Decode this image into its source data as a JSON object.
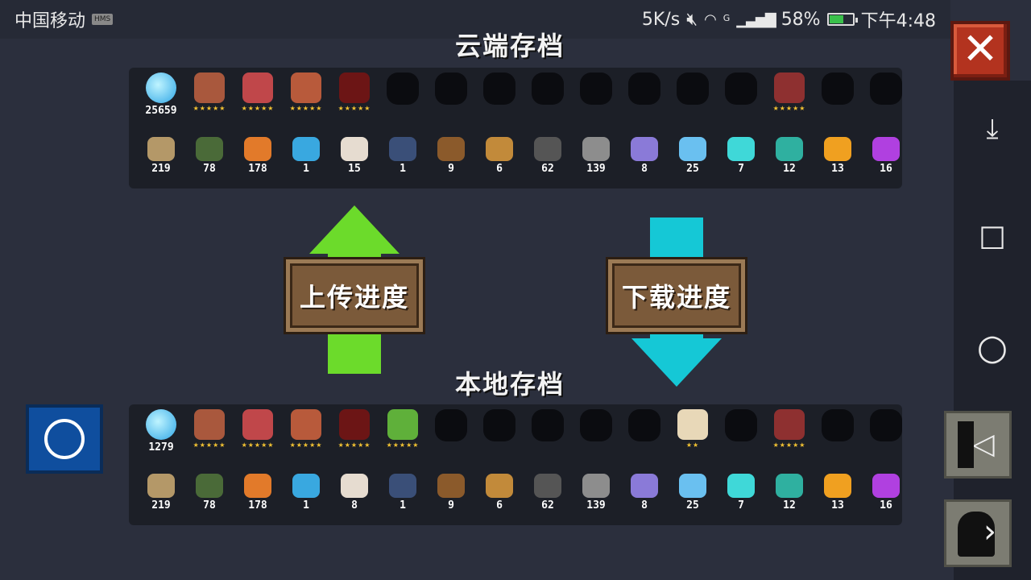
{
  "status_bar": {
    "carrier": "中国移动",
    "hms_badge": "HMS",
    "speed": "5K/s",
    "network_type": "G",
    "battery_percent": "58%",
    "battery_level": 0.58,
    "time": "下午4:48"
  },
  "cloud_save": {
    "title": "云端存档",
    "gem_count": "25659",
    "characters": [
      {
        "icon": "knight-character-icon",
        "unlocked": true,
        "stars": "★★★★★",
        "color": "#a9583d"
      },
      {
        "icon": "rogue-character-icon",
        "unlocked": true,
        "stars": "★★★★★",
        "color": "#c0474a"
      },
      {
        "icon": "wizard-character-icon",
        "unlocked": true,
        "stars": "★★★★★",
        "color": "#b85a3b"
      },
      {
        "icon": "assassin-character-icon",
        "unlocked": true,
        "stars": "★★★★★",
        "color": "#6c1515"
      },
      {
        "icon": "locked-character-icon",
        "unlocked": false,
        "stars": ""
      },
      {
        "icon": "locked-character-icon",
        "unlocked": false,
        "stars": ""
      },
      {
        "icon": "locked-character-icon",
        "unlocked": false,
        "stars": ""
      },
      {
        "icon": "locked-character-icon",
        "unlocked": false,
        "stars": ""
      },
      {
        "icon": "locked-character-icon",
        "unlocked": false,
        "stars": ""
      },
      {
        "icon": "locked-character-icon",
        "unlocked": false,
        "stars": ""
      },
      {
        "icon": "locked-character-icon",
        "unlocked": false,
        "stars": ""
      },
      {
        "icon": "locked-character-icon",
        "unlocked": false,
        "stars": ""
      },
      {
        "icon": "robot-character-icon",
        "unlocked": true,
        "stars": "★★★★★",
        "color": "#8e3030"
      },
      {
        "icon": "locked-character-icon",
        "unlocked": false,
        "stars": ""
      },
      {
        "icon": "locked-character-icon",
        "unlocked": false,
        "stars": ""
      }
    ],
    "materials": [
      {
        "icon": "wood-material-icon",
        "count": "219",
        "color": "#b49868"
      },
      {
        "icon": "battery-material-icon",
        "count": "78",
        "color": "#4a6a38"
      },
      {
        "icon": "ore-material-icon",
        "count": "178",
        "color": "#e27a2a"
      },
      {
        "icon": "energy-orb-icon",
        "count": "1",
        "color": "#39a8e0"
      },
      {
        "icon": "fabric-material-icon",
        "count": "15",
        "color": "#e6dcd0"
      },
      {
        "icon": "compass-material-icon",
        "count": "1",
        "color": "#3a4f78"
      },
      {
        "icon": "horn-material-icon",
        "count": "9",
        "color": "#8b5a2b"
      },
      {
        "icon": "feather-material-icon",
        "count": "6",
        "color": "#c28a3a"
      },
      {
        "icon": "gear-material-icon",
        "count": "62",
        "color": "#555"
      },
      {
        "icon": "iron-material-icon",
        "count": "139",
        "color": "#8d8d8d"
      },
      {
        "icon": "purple-crystal-icon",
        "count": "8",
        "color": "#8a7ad8"
      },
      {
        "icon": "blue-crystal-icon",
        "count": "25",
        "color": "#6ac0f0"
      },
      {
        "icon": "cyan-crystal-icon",
        "count": "7",
        "color": "#3fd8d8"
      },
      {
        "icon": "teal-crystal-icon",
        "count": "12",
        "color": "#2fb0a0"
      },
      {
        "icon": "orange-crystal-icon",
        "count": "13",
        "color": "#f0a020"
      },
      {
        "icon": "violet-crystal-icon",
        "count": "16",
        "color": "#b040e0"
      }
    ]
  },
  "local_save": {
    "title": "本地存档",
    "gem_count": "1279",
    "characters": [
      {
        "icon": "knight-character-icon",
        "unlocked": true,
        "stars": "★★★★★",
        "color": "#a9583d"
      },
      {
        "icon": "rogue-character-icon",
        "unlocked": true,
        "stars": "★★★★★",
        "color": "#c0474a"
      },
      {
        "icon": "wizard-character-icon",
        "unlocked": true,
        "stars": "★★★★★",
        "color": "#b85a3b"
      },
      {
        "icon": "assassin-character-icon",
        "unlocked": true,
        "stars": "★★★★★",
        "color": "#6c1515"
      },
      {
        "icon": "engineer-character-icon",
        "unlocked": true,
        "stars": "★★★★★",
        "color": "#5fb03a"
      },
      {
        "icon": "locked-character-icon",
        "unlocked": false,
        "stars": ""
      },
      {
        "icon": "locked-character-icon",
        "unlocked": false,
        "stars": ""
      },
      {
        "icon": "locked-character-icon",
        "unlocked": false,
        "stars": ""
      },
      {
        "icon": "locked-character-icon",
        "unlocked": false,
        "stars": ""
      },
      {
        "icon": "locked-character-icon",
        "unlocked": false,
        "stars": ""
      },
      {
        "icon": "priest-character-icon",
        "unlocked": true,
        "stars": "★★",
        "color": "#e8d8b8"
      },
      {
        "icon": "locked-character-icon",
        "unlocked": false,
        "stars": ""
      },
      {
        "icon": "robot-character-icon",
        "unlocked": true,
        "stars": "★★★★★",
        "color": "#8e3030"
      },
      {
        "icon": "locked-character-icon",
        "unlocked": false,
        "stars": ""
      },
      {
        "icon": "locked-character-icon",
        "unlocked": false,
        "stars": ""
      }
    ],
    "materials": [
      {
        "icon": "wood-material-icon",
        "count": "219",
        "color": "#b49868"
      },
      {
        "icon": "battery-material-icon",
        "count": "78",
        "color": "#4a6a38"
      },
      {
        "icon": "ore-material-icon",
        "count": "178",
        "color": "#e27a2a"
      },
      {
        "icon": "energy-orb-icon",
        "count": "1",
        "color": "#39a8e0"
      },
      {
        "icon": "fabric-material-icon",
        "count": "8",
        "color": "#e6dcd0"
      },
      {
        "icon": "compass-material-icon",
        "count": "1",
        "color": "#3a4f78"
      },
      {
        "icon": "horn-material-icon",
        "count": "9",
        "color": "#8b5a2b"
      },
      {
        "icon": "feather-material-icon",
        "count": "6",
        "color": "#c28a3a"
      },
      {
        "icon": "gear-material-icon",
        "count": "62",
        "color": "#555"
      },
      {
        "icon": "iron-material-icon",
        "count": "139",
        "color": "#8d8d8d"
      },
      {
        "icon": "purple-crystal-icon",
        "count": "8",
        "color": "#8a7ad8"
      },
      {
        "icon": "blue-crystal-icon",
        "count": "25",
        "color": "#6ac0f0"
      },
      {
        "icon": "cyan-crystal-icon",
        "count": "7",
        "color": "#3fd8d8"
      },
      {
        "icon": "teal-crystal-icon",
        "count": "12",
        "color": "#2fb0a0"
      },
      {
        "icon": "orange-crystal-icon",
        "count": "13",
        "color": "#f0a020"
      },
      {
        "icon": "violet-crystal-icon",
        "count": "16",
        "color": "#b040e0"
      }
    ]
  },
  "actions": {
    "upload_label": "上传进度",
    "download_label": "下载进度",
    "upload_color": "#6cdb2b",
    "download_color": "#15c8d6",
    "close_glyph": "✕"
  },
  "nav": {
    "pull_down_glyph": "⤓",
    "recent_glyph": "☐",
    "home_glyph": "○",
    "back_glyph": "◁",
    "forward_glyph": "›"
  }
}
